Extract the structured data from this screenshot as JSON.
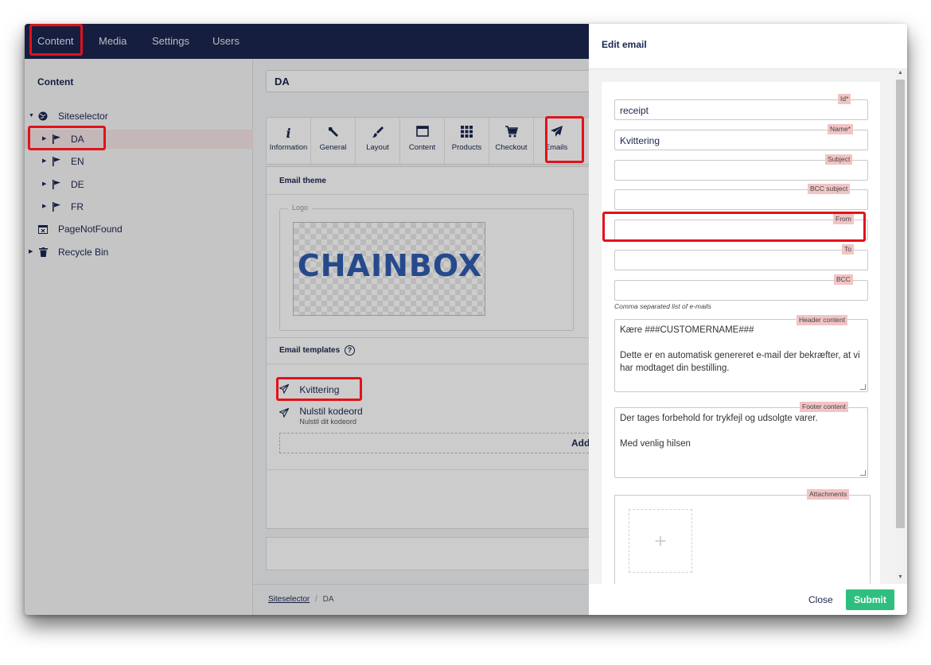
{
  "topnav": {
    "items": [
      "Content",
      "Media",
      "Settings",
      "Users"
    ]
  },
  "sidebar": {
    "title": "Content",
    "tree": [
      {
        "label": "Siteselector",
        "icon": "globe-icon"
      },
      {
        "label": "DA",
        "icon": "flag-icon"
      },
      {
        "label": "EN",
        "icon": "flag-icon"
      },
      {
        "label": "DE",
        "icon": "flag-icon"
      },
      {
        "label": "FR",
        "icon": "flag-icon"
      },
      {
        "label": "PageNotFound",
        "icon": "page-not-found-icon"
      },
      {
        "label": "Recycle Bin",
        "icon": "trash-icon"
      }
    ]
  },
  "main": {
    "header_value": "DA",
    "tabs": [
      {
        "label": "Information",
        "icon": "info-icon"
      },
      {
        "label": "General",
        "icon": "wrench-icon"
      },
      {
        "label": "Layout",
        "icon": "brush-icon"
      },
      {
        "label": "Content",
        "icon": "window-icon"
      },
      {
        "label": "Products",
        "icon": "grid-icon"
      },
      {
        "label": "Checkout",
        "icon": "cart-icon"
      },
      {
        "label": "Emails",
        "icon": "paper-plane-icon"
      }
    ],
    "email_theme_heading": "Email theme",
    "logo_legend": "Logo",
    "logo_text": "CHAINBOX",
    "email_templates_heading": "Email templates",
    "templates": [
      {
        "title": "Kvittering",
        "subtitle": ""
      },
      {
        "title": "Nulstil kodeord",
        "subtitle": "Nulstil dit kodeord"
      }
    ],
    "add_label": "Add",
    "breadcrumb": {
      "link": "Siteselector",
      "separator": "/",
      "current": "DA"
    }
  },
  "drawer": {
    "title": "Edit email",
    "fields": {
      "id": {
        "label": "Id*",
        "value": "receipt"
      },
      "name": {
        "label": "Name*",
        "value": "Kvittering"
      },
      "subject": {
        "label": "Subject",
        "value": ""
      },
      "bcc_subject": {
        "label": "BCC subject",
        "value": ""
      },
      "from": {
        "label": "From",
        "value": ""
      },
      "to": {
        "label": "To",
        "value": ""
      },
      "bcc": {
        "label": "BCC",
        "value": "",
        "hint": "Comma separated list of e-mails"
      },
      "header_content": {
        "label": "Header content",
        "value": "Kære ###CUSTOMERNAME###\n\nDette er en automatisk genereret e-mail der bekræfter, at vi har modtaget din bestilling."
      },
      "footer_content": {
        "label": "Footer content",
        "value": "Der tages forbehold for trykfejl og udsolgte varer.\n\nMed venlig hilsen"
      },
      "attachments": {
        "label": "Attachments",
        "add_symbol": "+"
      }
    },
    "close_label": "Close",
    "submit_label": "Submit"
  },
  "colors": {
    "navy": "#1b264f",
    "annotation_red": "#e0121b",
    "submit_green": "#2ebf7f",
    "label_tag": "#f2c4c4"
  }
}
